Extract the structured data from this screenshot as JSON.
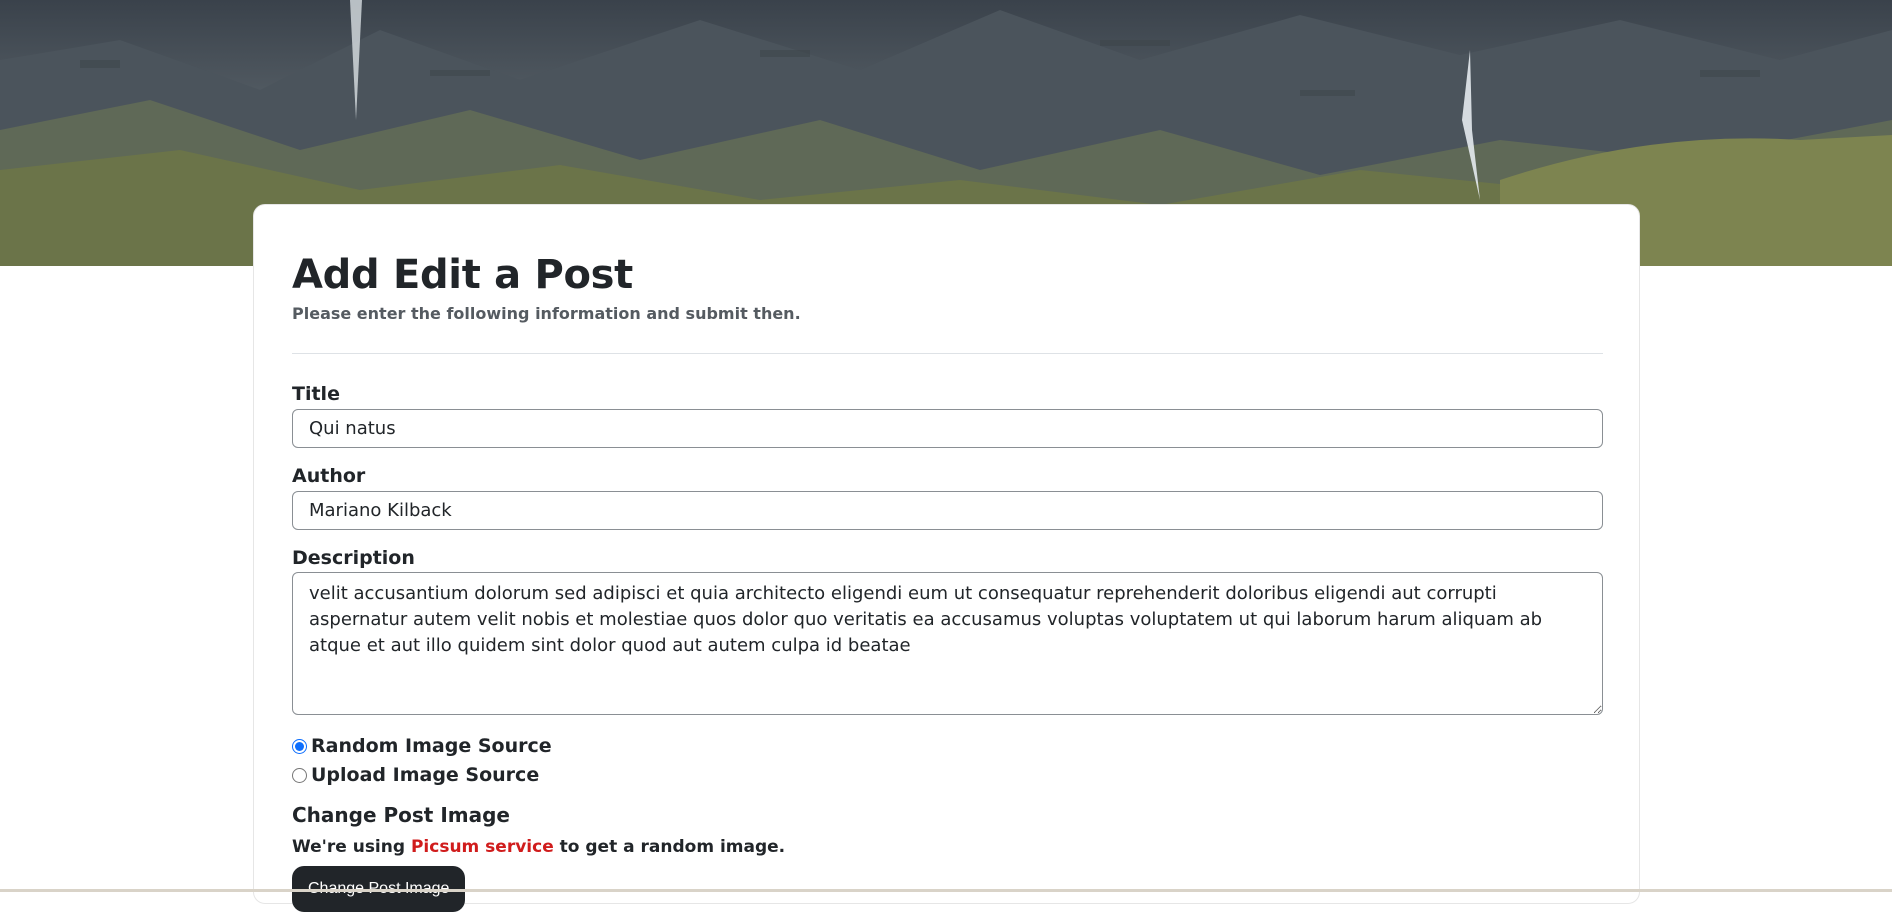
{
  "hero": {
    "image_icon": "mountain-waterfall-photo"
  },
  "form": {
    "heading": "Add Edit a Post",
    "subtitle": "Please enter the following information and submit then.",
    "title_label": "Title",
    "title_value": "Qui natus",
    "author_label": "Author",
    "author_value": "Mariano Kilback",
    "description_label": "Description",
    "description_value": "velit accusantium dolorum sed adipisci et quia architecto eligendi eum ut consequatur reprehenderit doloribus eligendi aut corrupti aspernatur autem velit nobis et molestiae quos dolor quo veritatis ea accusamus voluptas voluptatem ut qui laborum harum aliquam ab atque et aut illo quidem sint dolor quod aut autem culpa id beatae",
    "radio_random_label": "Random Image Source",
    "radio_random_checked": true,
    "radio_upload_label": "Upload Image Source",
    "radio_upload_checked": false,
    "change_image_heading": "Change Post Image",
    "note_prefix": "We're using",
    "note_link": "Picsum service",
    "note_suffix": "to get a random image.",
    "change_image_button": "Change Post Image"
  },
  "colors": {
    "link": "#d01c1c",
    "button_bg": "#212529",
    "radio_accent": "#0d6efd"
  }
}
